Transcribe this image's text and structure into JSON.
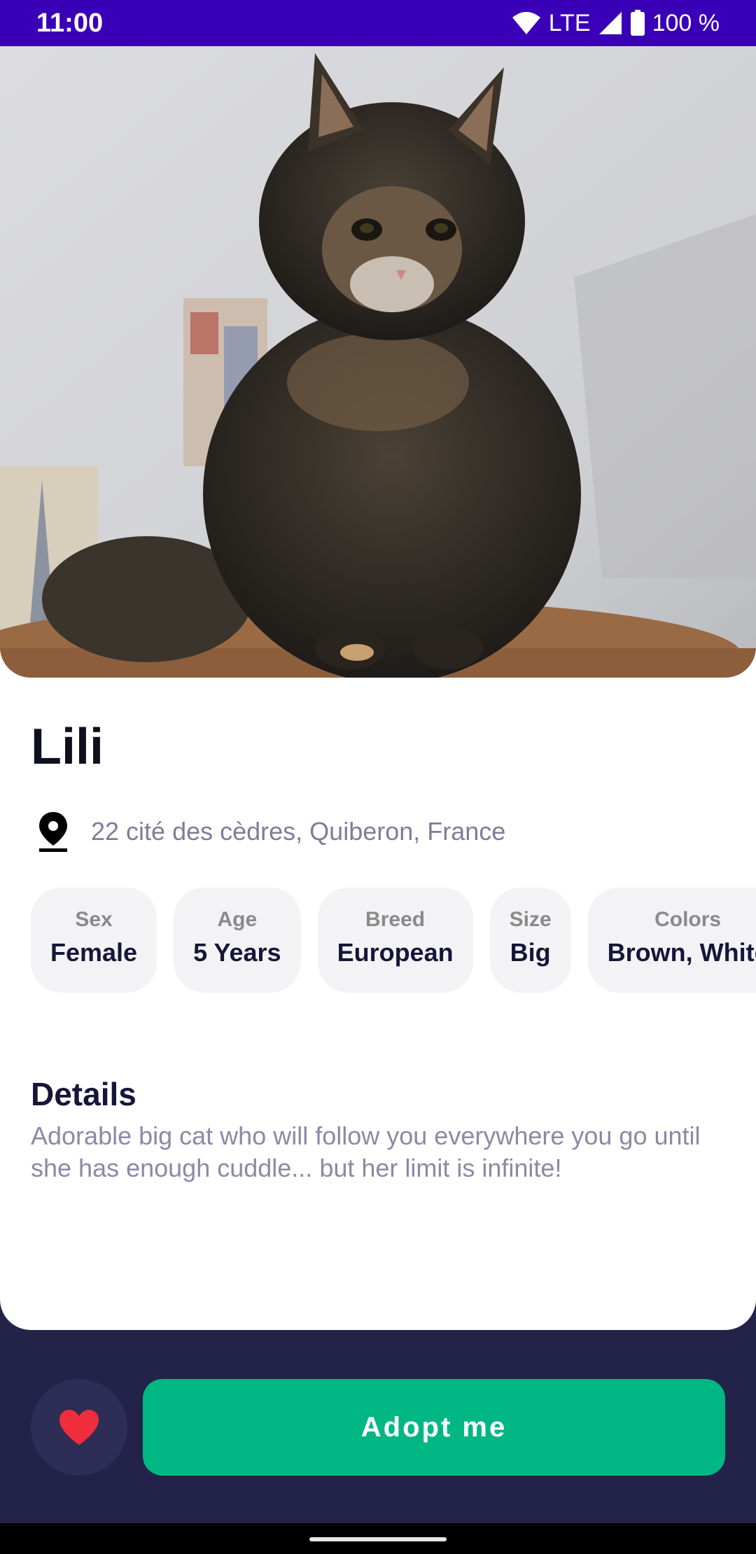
{
  "status_bar": {
    "time": "11:00",
    "network": "LTE",
    "battery": "100 %",
    "background_color": "#3a00b8"
  },
  "pet": {
    "name": "Lili",
    "location": "22 cité des cèdres, Quiberon, France",
    "photo_subject": "long-haired tabby cat sitting on a scratching post"
  },
  "attributes": [
    {
      "label": "Sex",
      "value": "Female"
    },
    {
      "label": "Age",
      "value": "5 Years"
    },
    {
      "label": "Breed",
      "value": "European"
    },
    {
      "label": "Size",
      "value": "Big"
    },
    {
      "label": "Colors",
      "value": "Brown, White"
    }
  ],
  "details": {
    "title": "Details",
    "text": "Adorable big cat who will follow you everywhere you go until she has enough cuddle... but her limit is infinite!"
  },
  "actions": {
    "adopt_label": "Adopt me",
    "favorite_icon": "heart-icon"
  },
  "colors": {
    "accent": "#00b783",
    "bottom_bar": "#23234a",
    "heart": "#f02d3a",
    "title_text": "#16163a",
    "muted_text": "#8a8aa6"
  }
}
